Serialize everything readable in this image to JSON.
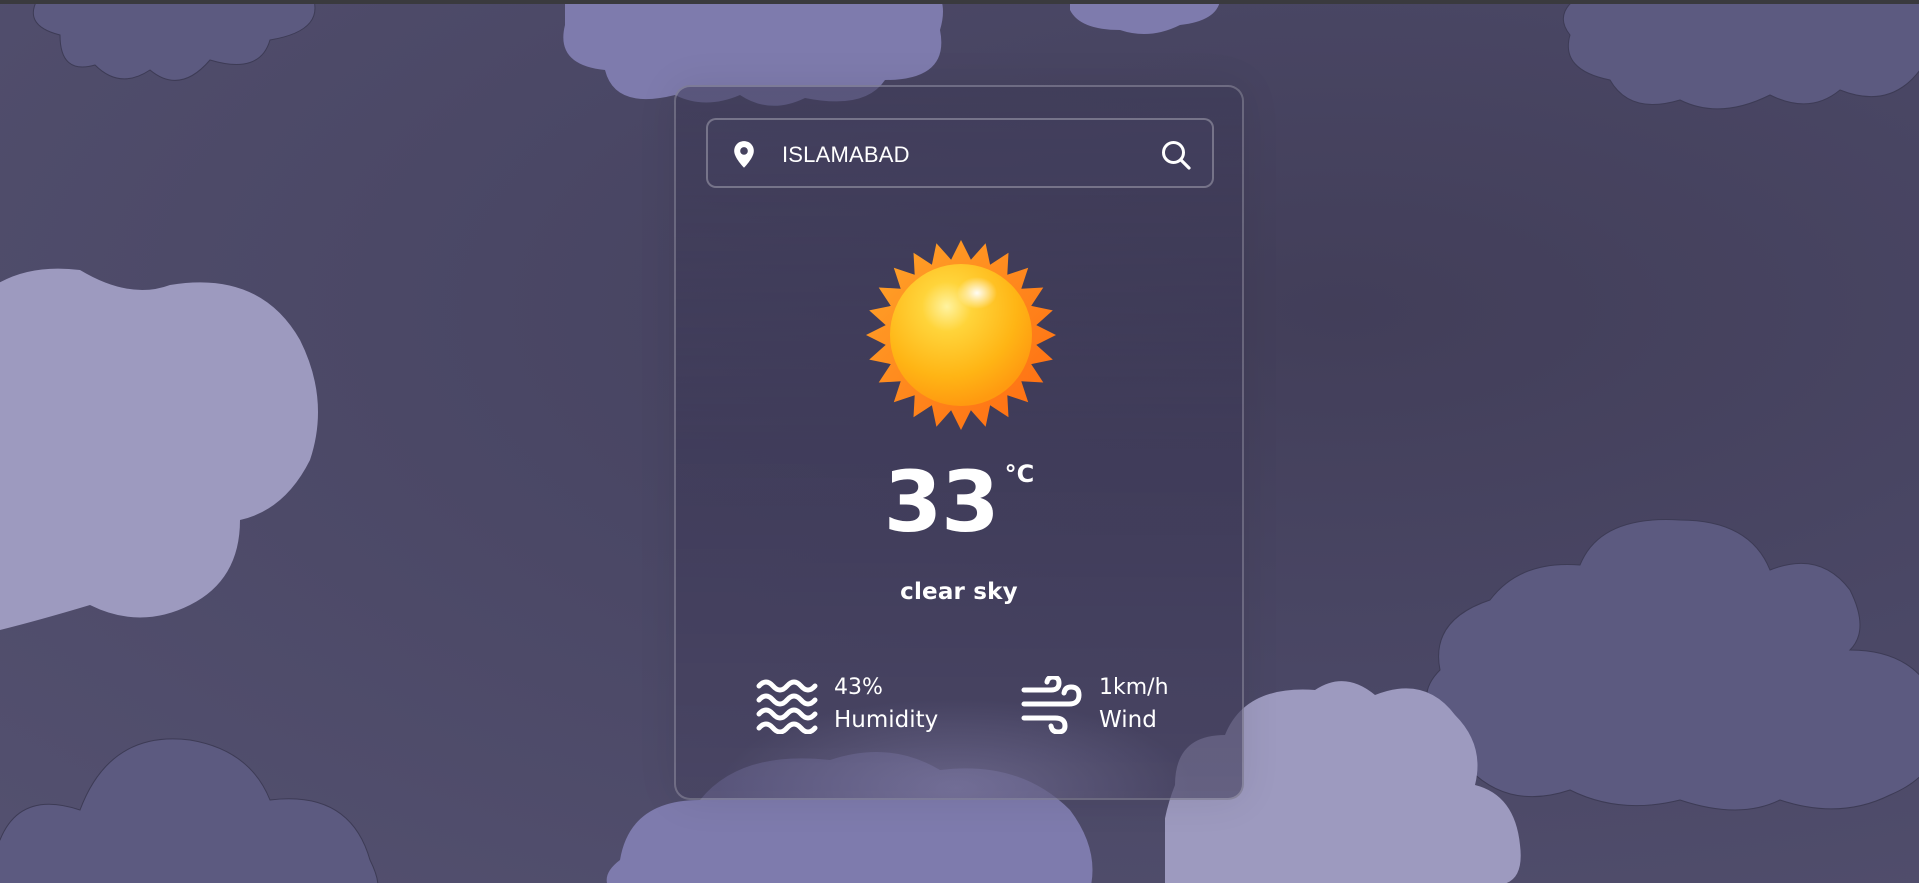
{
  "app": {
    "background_color": "#4d4a6a",
    "card_border_color": "#7c7a95"
  },
  "search": {
    "value": "ISLAMABAD",
    "placeholder": "",
    "location_icon": "map-pin-icon",
    "search_icon": "search-icon"
  },
  "weather": {
    "icon": "sun-icon",
    "temperature": "33",
    "unit": "°C",
    "description": "clear sky"
  },
  "stats": {
    "humidity": {
      "value": "43%",
      "label": "Humidity",
      "icon": "humidity-waves-icon"
    },
    "wind": {
      "value": "1km/h",
      "label": "Wind",
      "icon": "wind-icon"
    }
  },
  "colors": {
    "cloud_light": "#9d9abf",
    "cloud_medium": "#5c5a80",
    "cloud_violet": "#7e7bad",
    "sun_core": "#ffc21a",
    "sun_rays": "#ff8a15",
    "text": "#ffffff"
  }
}
